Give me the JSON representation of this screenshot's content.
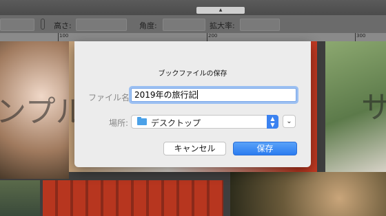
{
  "properties": {
    "height_label": "高さ:",
    "angle_label": "角度:",
    "scale_label": "拡大率:"
  },
  "ruler": {
    "labels": [
      "100",
      "200",
      "300"
    ]
  },
  "canvas": {
    "text_left": "ンプル",
    "text_right": "サ"
  },
  "dialog": {
    "title": "ブックファイルの保存",
    "name_label": "ファイル名",
    "name_value": "2019年の旅行記",
    "location_label": "場所:",
    "location_value": "デスクトップ",
    "cancel_label": "キャンセル",
    "save_label": "保存"
  },
  "colors": {
    "accent": "#3b82f0",
    "dialog_bg": "#ececec"
  }
}
